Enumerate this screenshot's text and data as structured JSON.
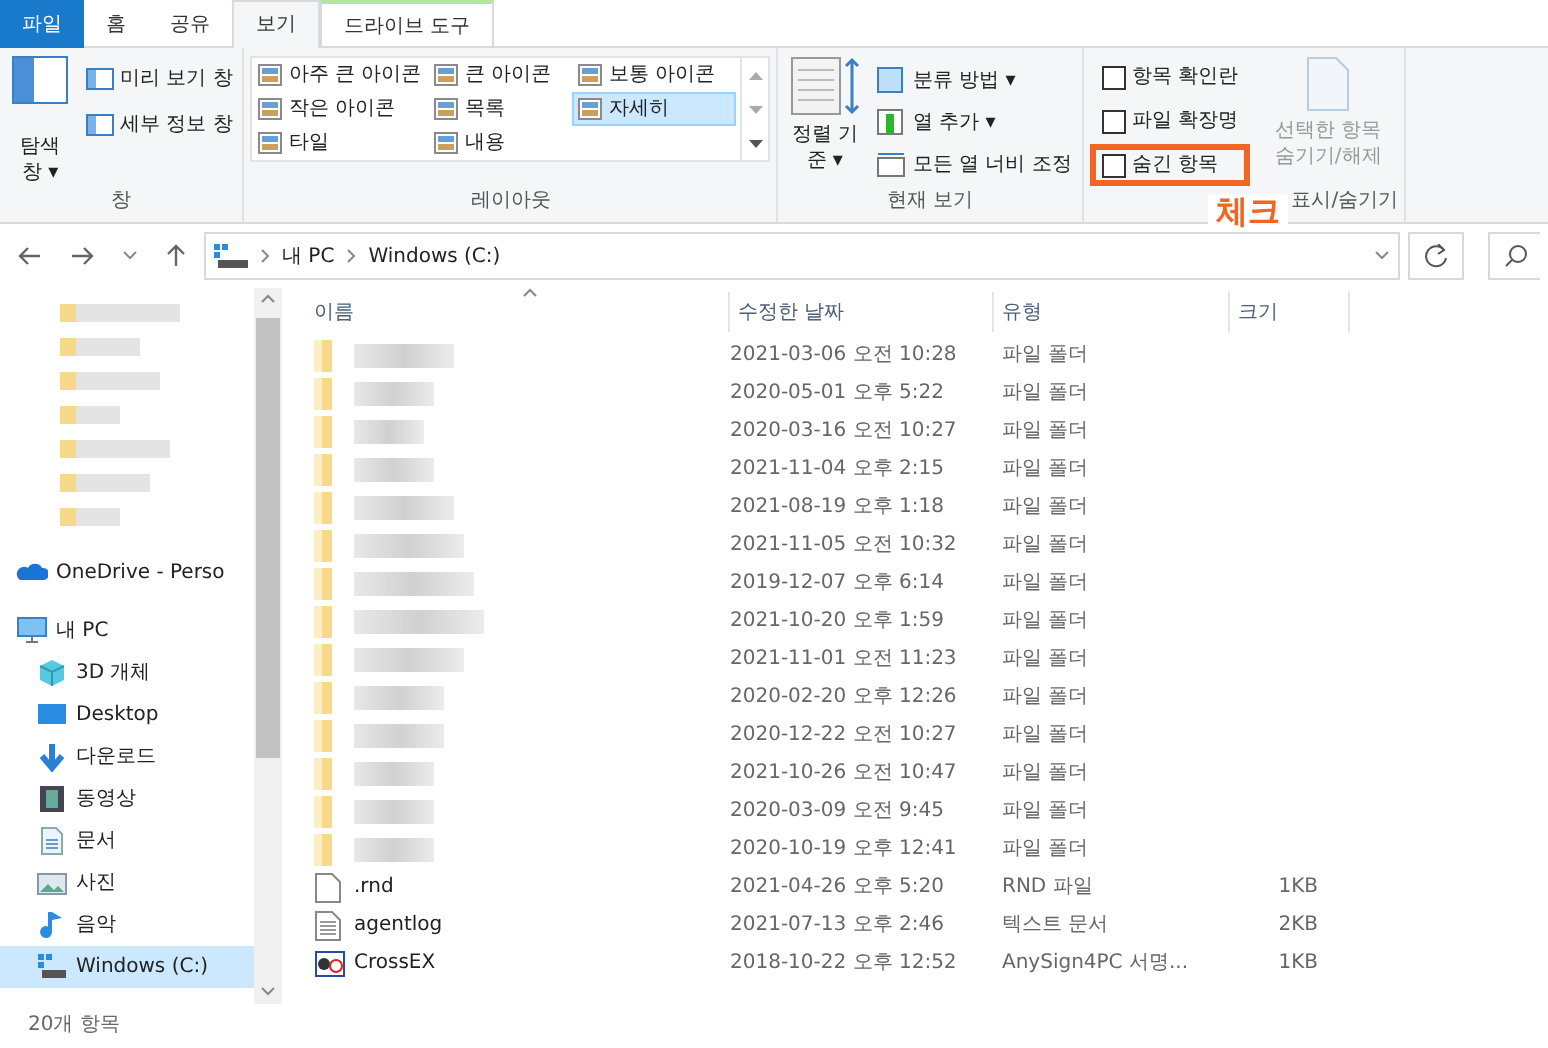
{
  "ribbon_tabs": [
    {
      "label": "파일",
      "kind": "file",
      "selected": false
    },
    {
      "label": "홈",
      "kind": "normal",
      "selected": false
    },
    {
      "label": "공유",
      "kind": "normal",
      "selected": false
    },
    {
      "label": "보기",
      "kind": "normal",
      "selected": true
    },
    {
      "label": "드라이브 도구",
      "kind": "context",
      "selected": false
    }
  ],
  "pane_group": {
    "label": "창",
    "nav_pane": {
      "label": "탐색 창",
      "caret": "▾"
    },
    "items": [
      "미리 보기 창",
      "세부 정보 창"
    ]
  },
  "layout_group": {
    "label": "레이아웃",
    "options": [
      {
        "label": "아주 큰 아이콘",
        "selected": false
      },
      {
        "label": "큰 아이콘",
        "selected": false
      },
      {
        "label": "보통 아이콘",
        "selected": false
      },
      {
        "label": "작은 아이콘",
        "selected": false
      },
      {
        "label": "목록",
        "selected": false
      },
      {
        "label": "자세히",
        "selected": true
      },
      {
        "label": "타일",
        "selected": false
      },
      {
        "label": "내용",
        "selected": false
      }
    ]
  },
  "current_view_group": {
    "label": "현재 보기",
    "sort": {
      "label": "정렬 기준",
      "caret": "▾"
    },
    "items": [
      {
        "label": "분류 방법",
        "caret": "▾"
      },
      {
        "label": "열 추가",
        "caret": "▾"
      },
      {
        "label": "모든 열 너비 조정"
      }
    ]
  },
  "show_hide_group": {
    "label": "표시/숨기기",
    "checkboxes": [
      {
        "label": "항목 확인란",
        "checked": false,
        "highlighted": false
      },
      {
        "label": "파일 확장명",
        "checked": false,
        "highlighted": false
      },
      {
        "label": "숨긴 항목",
        "checked": false,
        "highlighted": true
      }
    ],
    "hide_selected": {
      "label": "선택한 항목 숨기기/해제",
      "disabled": true
    }
  },
  "annotation": {
    "label": "체크"
  },
  "address_bar": {
    "path": [
      "내 PC",
      "Windows (C:)"
    ]
  },
  "sidebar": {
    "items": [
      {
        "label": "OneDrive - Perso",
        "kind": "cloud",
        "selected": false
      },
      {
        "label": "내 PC",
        "kind": "pc",
        "selected": false,
        "children": [
          {
            "label": "3D 개체",
            "kind": "cube",
            "selected": false
          },
          {
            "label": "Desktop",
            "kind": "desktop",
            "selected": false
          },
          {
            "label": "다운로드",
            "kind": "download",
            "selected": false
          },
          {
            "label": "동영상",
            "kind": "video",
            "selected": false
          },
          {
            "label": "문서",
            "kind": "document",
            "selected": false
          },
          {
            "label": "사진",
            "kind": "picture",
            "selected": false
          },
          {
            "label": "음악",
            "kind": "music",
            "selected": false
          },
          {
            "label": "Windows (C:)",
            "kind": "drive",
            "selected": true
          }
        ]
      }
    ]
  },
  "table": {
    "columns": [
      "이름",
      "수정한 날짜",
      "유형",
      "크기"
    ],
    "rows": [
      {
        "kind": "folder",
        "modified": "2021-03-06 오전 10:28",
        "type": "파일 폴더"
      },
      {
        "kind": "folder",
        "modified": "2020-05-01 오후 5:22",
        "type": "파일 폴더"
      },
      {
        "kind": "folder",
        "modified": "2020-03-16 오전 10:27",
        "type": "파일 폴더"
      },
      {
        "kind": "folder",
        "modified": "2021-11-04 오후 2:15",
        "type": "파일 폴더"
      },
      {
        "kind": "folder",
        "modified": "2021-08-19 오후 1:18",
        "type": "파일 폴더"
      },
      {
        "kind": "folder",
        "modified": "2021-11-05 오전 10:32",
        "type": "파일 폴더"
      },
      {
        "kind": "folder",
        "modified": "2019-12-07 오후 6:14",
        "type": "파일 폴더"
      },
      {
        "kind": "folder",
        "modified": "2021-10-20 오후 1:59",
        "type": "파일 폴더"
      },
      {
        "kind": "folder",
        "modified": "2021-11-01 오전 11:23",
        "type": "파일 폴더"
      },
      {
        "kind": "folder",
        "modified": "2020-02-20 오후 12:26",
        "type": "파일 폴더"
      },
      {
        "kind": "folder",
        "modified": "2020-12-22 오전 10:27",
        "type": "파일 폴더"
      },
      {
        "kind": "folder",
        "modified": "2021-10-26 오전 10:47",
        "type": "파일 폴더"
      },
      {
        "kind": "folder",
        "modified": "2020-03-09 오전 9:45",
        "type": "파일 폴더"
      },
      {
        "kind": "folder",
        "modified": "2020-10-19 오후 12:41",
        "type": "파일 폴더"
      },
      {
        "kind": "blank",
        "name": ".rnd",
        "modified": "2021-04-26 오후 5:20",
        "type": "RND 파일",
        "size": "1KB"
      },
      {
        "kind": "text",
        "name": "agentlog",
        "modified": "2021-07-13 오후 2:46",
        "type": "텍스트 문서",
        "size": "2KB"
      },
      {
        "kind": "app",
        "name": "CrossEX",
        "modified": "2018-10-22 오후 12:52",
        "type": "AnySign4PC 서명...",
        "size": "1KB"
      }
    ]
  },
  "status_bar": {
    "count": "20개 항목"
  }
}
